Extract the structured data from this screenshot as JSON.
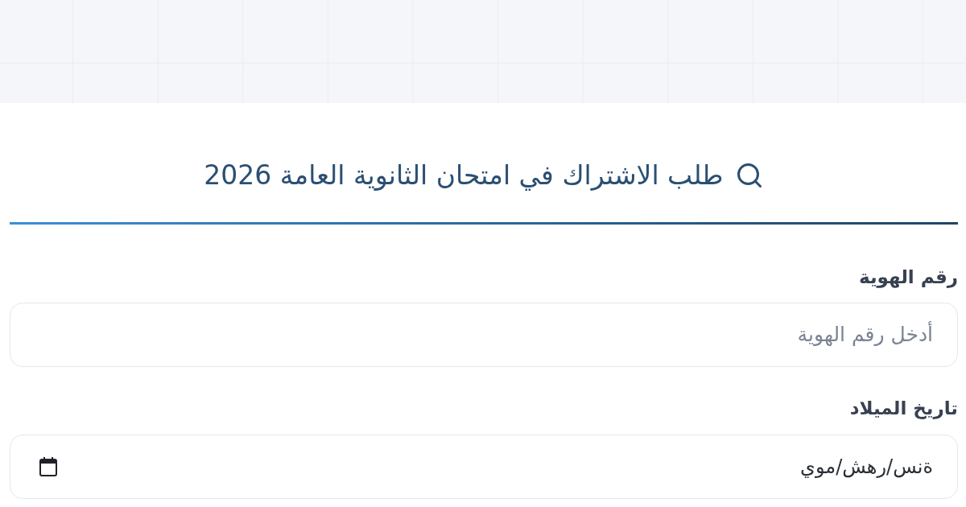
{
  "header": {
    "title": "طلب الاشتراك في امتحان الثانوية العامة 2026"
  },
  "fields": [
    {
      "kind": "text",
      "label": "رقم الهوية",
      "placeholder": "أدخل رقم الهوية"
    },
    {
      "kind": "date",
      "label": "تاريخ الميلاد",
      "placeholder": "ةنس/رهش/موي"
    }
  ]
}
